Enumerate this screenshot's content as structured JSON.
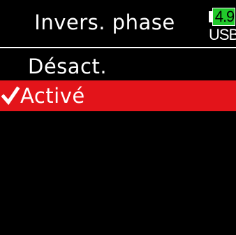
{
  "header": {
    "title": "Invers. phase"
  },
  "battery": {
    "value": "4.9",
    "source": "USB",
    "icon": "battery-icon",
    "fill_color": "#21c92b"
  },
  "menu": {
    "items": [
      {
        "label": "Désact.",
        "selected": false
      },
      {
        "label": "Activé",
        "selected": true
      }
    ],
    "check_icon": "checkmark-icon",
    "highlight_color": "#e3141a"
  }
}
